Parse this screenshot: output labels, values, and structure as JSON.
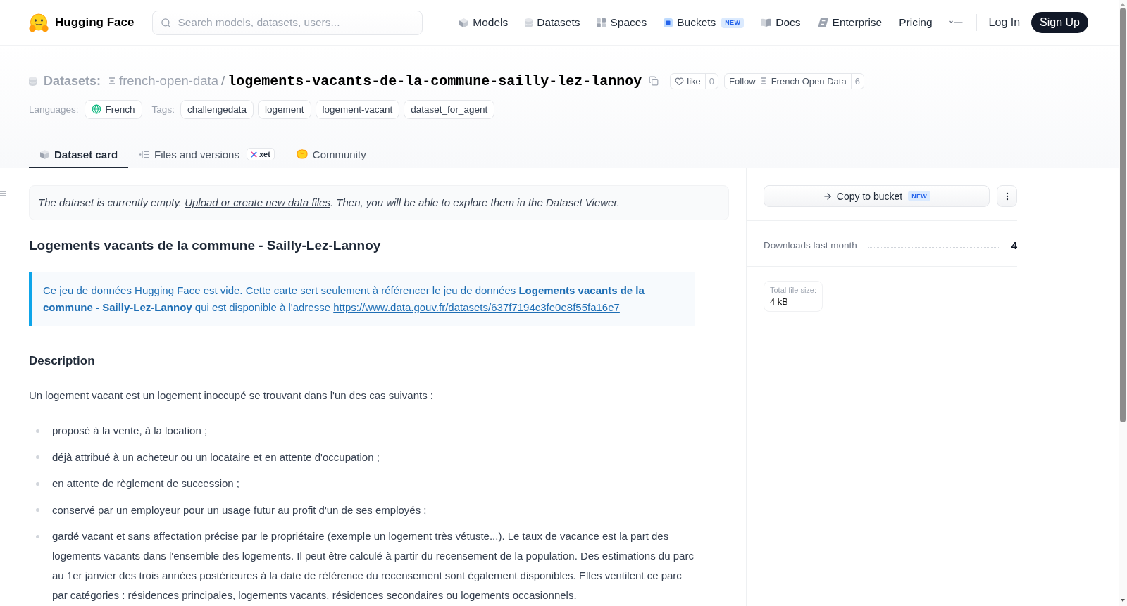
{
  "header": {
    "logo_text": "Hugging Face",
    "search": {
      "placeholder": "Search models, datasets, users..."
    },
    "nav": [
      {
        "kind": "models",
        "label": "Models"
      },
      {
        "kind": "datasets",
        "label": "Datasets"
      },
      {
        "kind": "spaces",
        "label": "Spaces"
      },
      {
        "kind": "buckets",
        "label": "Buckets",
        "badge": "NEW"
      },
      {
        "kind": "docs",
        "label": "Docs"
      },
      {
        "kind": "enterprise",
        "label": "Enterprise"
      },
      {
        "kind": "pricing",
        "label": "Pricing"
      }
    ],
    "log_in": "Log In",
    "sign_up": "Sign Up"
  },
  "repo": {
    "type_label": "Datasets:",
    "owner": "french-open-data",
    "separator": "/",
    "name": "logements-vacants-de-la-commune-sailly-lez-lannoy",
    "like": {
      "label": "like",
      "count": "0"
    },
    "follow": {
      "label": "Follow",
      "org": "French Open Data",
      "count": "6"
    },
    "languages_label": "Languages:",
    "languages": [
      "French"
    ],
    "tags_label": "Tags:",
    "tags": [
      "challengedata",
      "logement",
      "logement-vacant",
      "dataset_for_agent"
    ]
  },
  "tabs": [
    {
      "kind": "card",
      "label": "Dataset card",
      "selected": true
    },
    {
      "kind": "files",
      "label": "Files and versions",
      "badge": "xet",
      "selected": false
    },
    {
      "kind": "community",
      "label": "Community",
      "selected": false
    }
  ],
  "notice": {
    "text": "The dataset is currently empty.",
    "link": "Upload or create new data files",
    "after": ". Then, you will be able to explore them in the Dataset Viewer."
  },
  "card": {
    "title": "Logements vacants de la commune - Sailly-Lez-Lannoy",
    "callout": {
      "text": "Ce jeu de données Hugging Face est vide. Cette carte sert seulement à référencer le jeu de données **Logements vacants de la commune - Sailly-Lez-Lannoy** qui est disponible à l'adresse",
      "link": "https://www.data.gouv.fr/datasets/637f7194c3fe0e8f55fa16e7"
    },
    "description_heading": "Description",
    "intro": "Un logement vacant est un logement inoccupé se trouvant dans l'un des cas suivants :",
    "items": [
      "proposé à la vente, à la location ;",
      "déjà attribué à un acheteur ou un locataire et en attente d'occupation ;",
      "en attente de règlement de succession ;",
      "conservé par un employeur pour un usage futur au profit d'un de ses employés ;",
      "gardé vacant et sans affectation précise par le propriétaire (exemple un logement très vétuste...). Le taux de vacance est la part des logements vacants dans l'ensemble des logements. Il peut être calculé à partir du recensement de la population. Des estimations du parc au 1er janvier des trois années postérieures à la date de référence du recensement sont également disponibles. Elles ventilent ce parc par catégories : résidences principales, logements vacants, résidences secondaires ou logements occasionnels."
    ]
  },
  "sidebar": {
    "copy_button": {
      "label": "Copy to bucket",
      "badge": "NEW"
    },
    "downloads_label": "Downloads last month",
    "downloads": "4",
    "file_size_label": "Total file size:",
    "file_size": "4 kB"
  }
}
